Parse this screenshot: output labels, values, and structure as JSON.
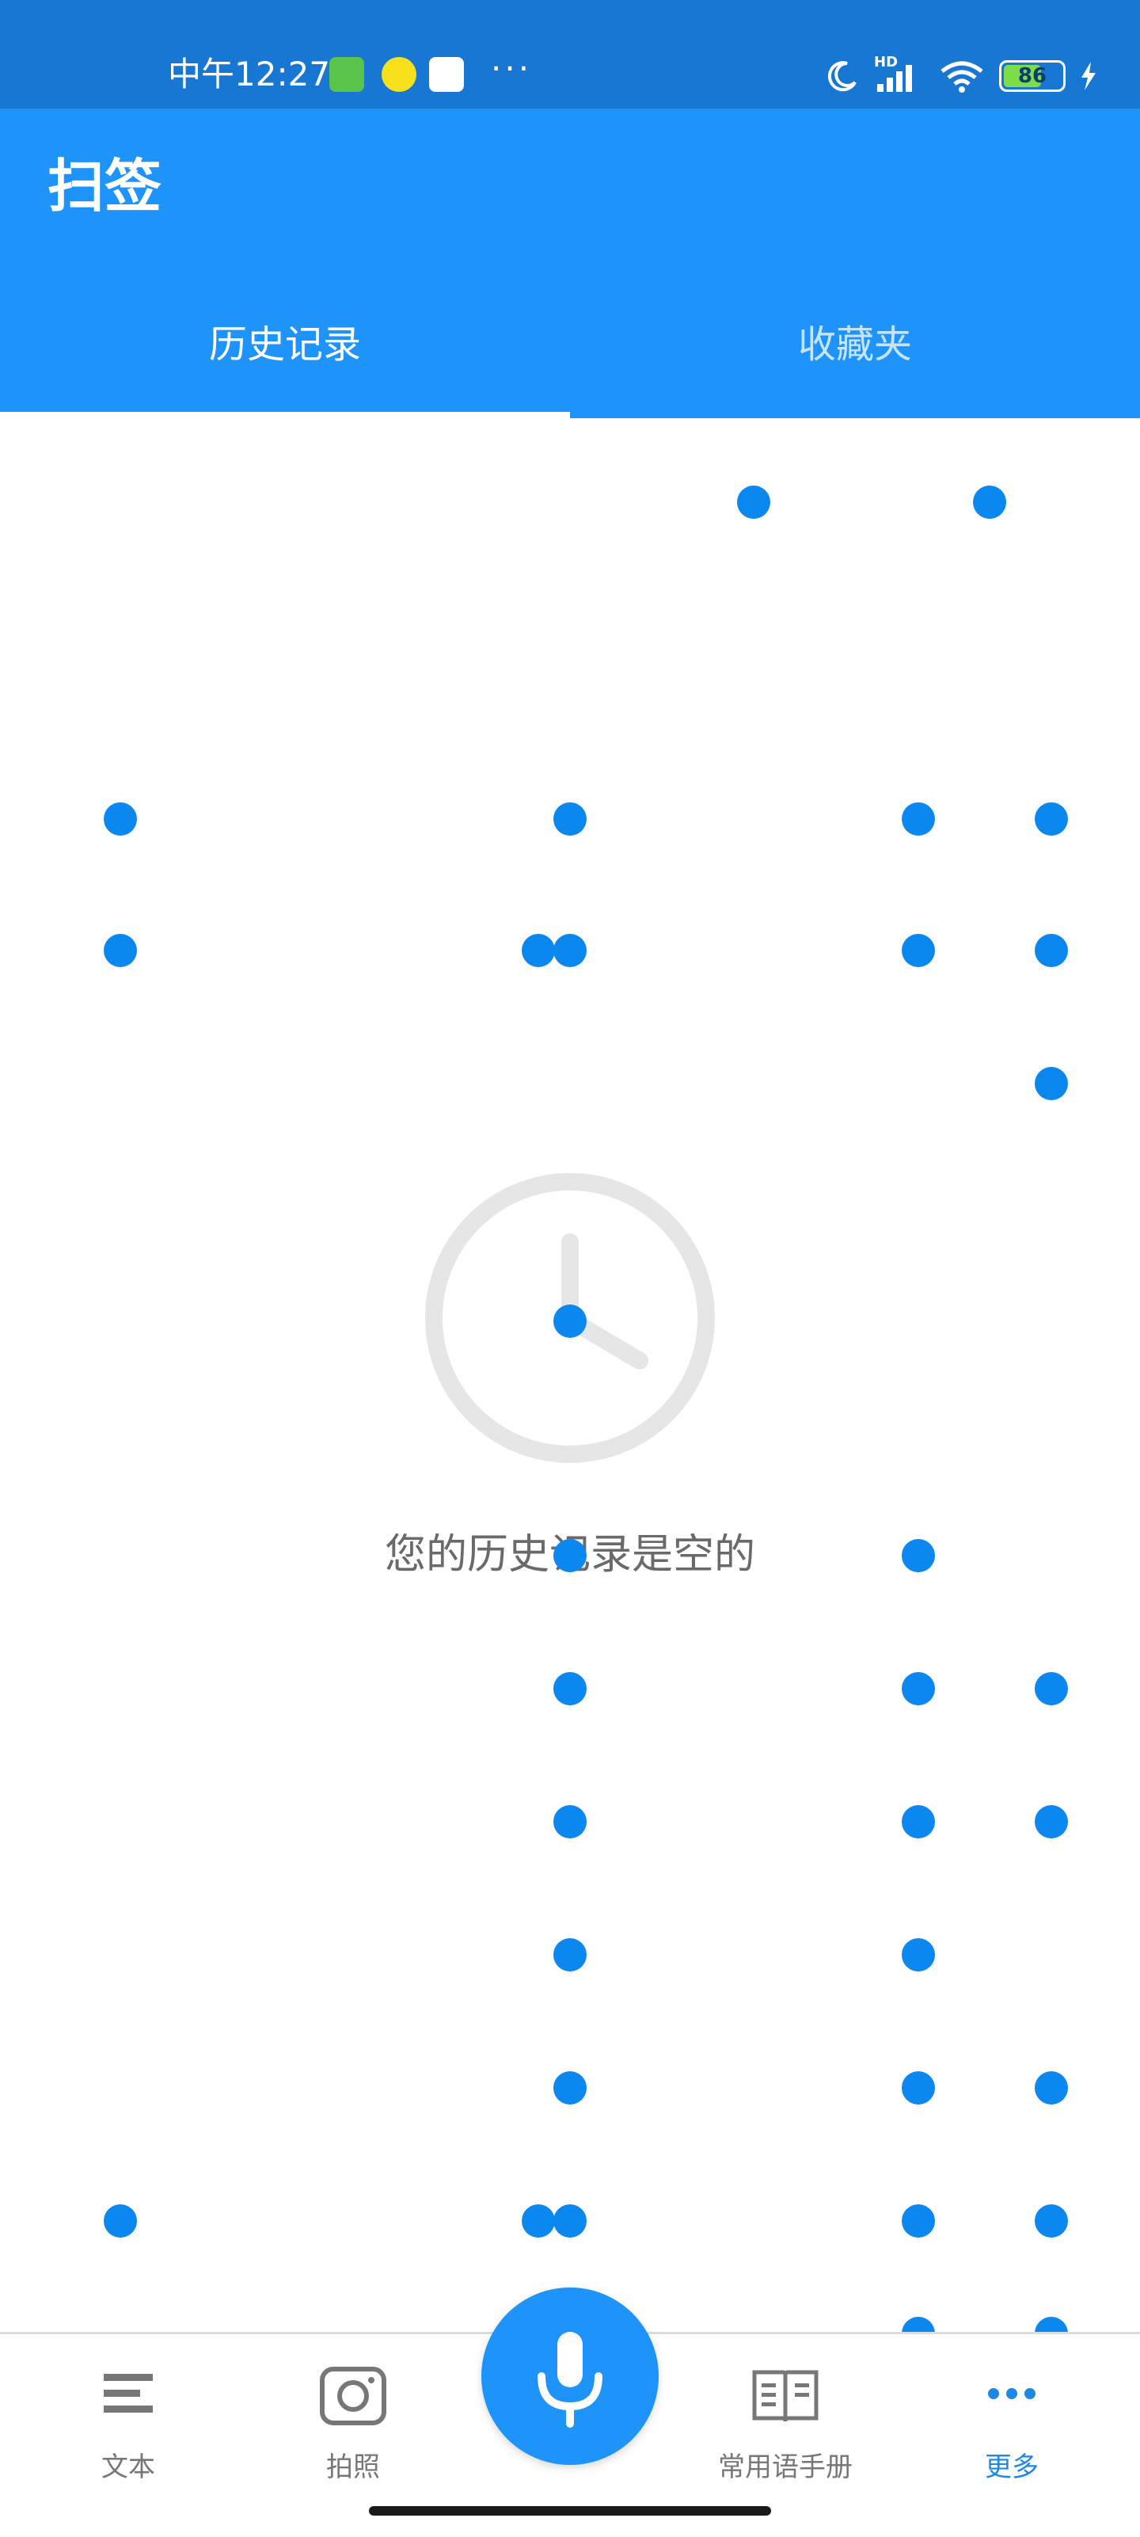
{
  "status_bar": {
    "time": "中午12:27",
    "battery": "86",
    "network": "HD"
  },
  "app": {
    "title": "扫签"
  },
  "tabs": [
    {
      "label": "历史记录",
      "active": true
    },
    {
      "label": "收藏夹",
      "active": false
    }
  ],
  "empty_state": {
    "message": "您的历史记录是空的",
    "icon": "clock-icon"
  },
  "bottom_nav": [
    {
      "label": "文本",
      "icon": "text-lines-icon"
    },
    {
      "label": "拍照",
      "icon": "camera-icon"
    },
    {
      "label": "",
      "icon": "microphone-icon"
    },
    {
      "label": "常用语手册",
      "icon": "phrasebook-icon"
    },
    {
      "label": "更多",
      "icon": "more-dots-icon",
      "active": true
    }
  ],
  "colors": {
    "status_bar": "#1877d2",
    "app_bar": "#1e94fb",
    "accent": "#1e88e5",
    "overlay_dot": "#0b88f0"
  }
}
